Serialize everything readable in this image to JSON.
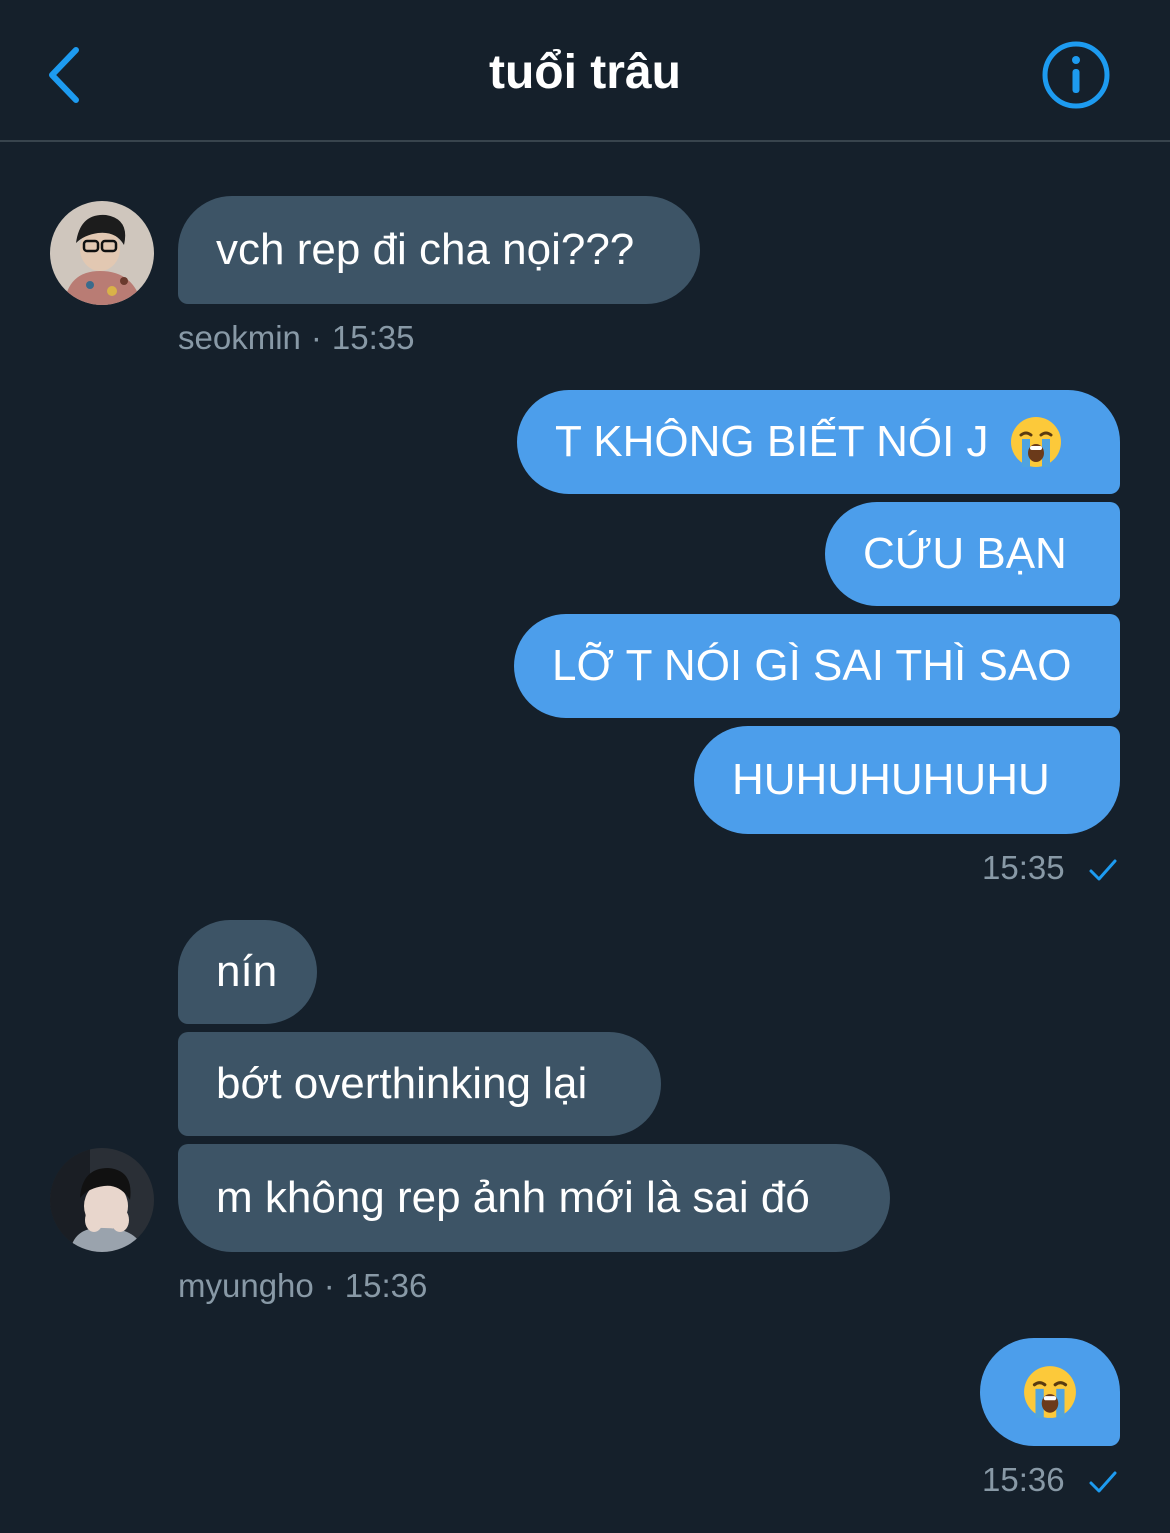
{
  "header": {
    "title": "tuổi trâu"
  },
  "messages": {
    "m1": {
      "text": "vch rep đi cha nọi???"
    },
    "meta1": {
      "sender": "seokmin",
      "sep": "·",
      "time": "15:35"
    },
    "m2": {
      "text": "T KHÔNG BIẾT NÓI J",
      "emoji": "loudly-crying-face"
    },
    "m3": {
      "text": "CỨU BẠN"
    },
    "m4": {
      "text": "LỠ T NÓI GÌ SAI THÌ SAO"
    },
    "m5": {
      "text": "HUHUHUHUHU"
    },
    "meta2": {
      "time": "15:35",
      "status": "sent-check-icon"
    },
    "m6": {
      "text": "nín"
    },
    "m7": {
      "text": "bớt overthinking lại"
    },
    "m8": {
      "text": "m không rep ảnh mới là sai đó"
    },
    "meta3": {
      "sender": "myungho",
      "sep": "·",
      "time": "15:36"
    },
    "m9": {
      "emoji": "loudly-crying-face"
    },
    "meta4": {
      "time": "15:36",
      "status": "sent-check-icon"
    }
  },
  "colors": {
    "background": "#15202b",
    "incoming_bubble": "#3d5466",
    "outgoing_bubble": "#4c9eeb",
    "accent": "#1d9bf0",
    "meta_text": "#8899a6"
  }
}
